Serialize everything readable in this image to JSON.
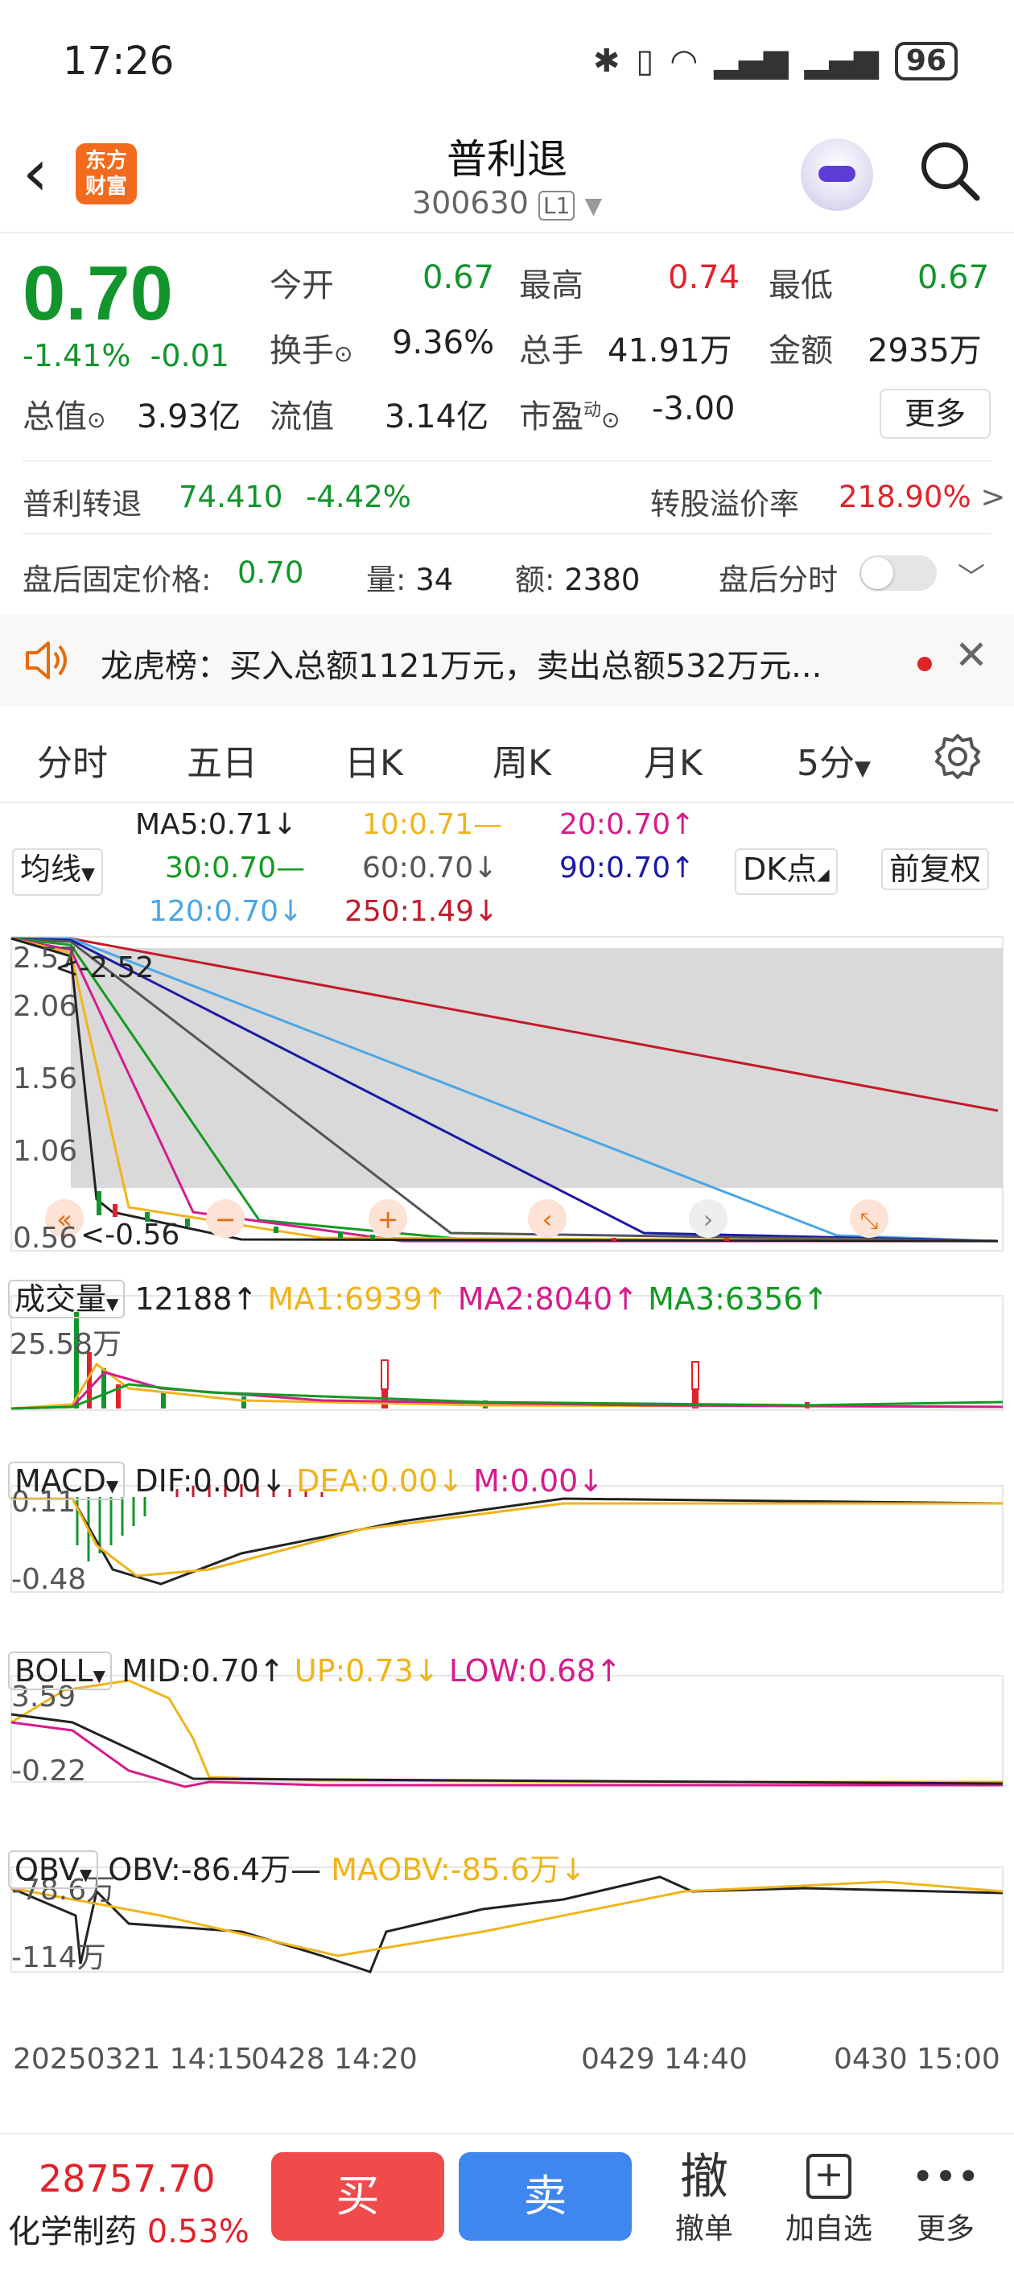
{
  "status_bar": {
    "time": "17:26",
    "battery": "96"
  },
  "nav": {
    "logo_line1": "东方",
    "logo_line2": "财富",
    "title": "普利退",
    "code": "300630",
    "level": "L1"
  },
  "quote": {
    "price": "0.70",
    "change_pct": "-1.41%",
    "change": "-0.01",
    "open_label": "今开",
    "open": "0.67",
    "high_label": "最高",
    "high": "0.74",
    "low_label": "最低",
    "low": "0.67",
    "turnover_label": "换手",
    "turnover": "9.36%",
    "volume_label": "总手",
    "volume": "41.91万",
    "amount_label": "金额",
    "amount": "2935万",
    "mktcap_label": "总值",
    "mktcap": "3.93亿",
    "float_label": "流值",
    "float": "3.14亿",
    "pe_label": "市盈",
    "pe_sup": "动",
    "pe": "-3.00",
    "more": "更多"
  },
  "bond": {
    "name": "普利转退",
    "price": "74.410",
    "pct": "-4.42%",
    "premium_label": "转股溢价率",
    "premium": "218.90%"
  },
  "after_hours": {
    "fixed_label": "盘后固定价格:",
    "fixed": "0.70",
    "vol_label": "量:",
    "vol": "34",
    "amt_label": "额:",
    "amt": "2380",
    "timeshare_label": "盘后分时"
  },
  "dragon": {
    "text": "龙虎榜：买入总额1121万元，卖出总额532万元..."
  },
  "tabs": [
    "分时",
    "五日",
    "日K",
    "周K",
    "月K",
    "5分"
  ],
  "ma_legend": {
    "selector": "均线",
    "dk": "DK点",
    "adjust": "前复权",
    "ma5": "MA5:0.71↓",
    "ma10": "10:0.71—",
    "ma20": "20:0.70↑",
    "ma30": "30:0.70—",
    "ma60": "60:0.70↓",
    "ma90": "90:0.70↑",
    "ma120": "120:0.70↓",
    "ma250": "250:1.49↓"
  },
  "main_chart": {
    "y1": "2.57",
    "y2": "2.06",
    "y3": "1.56",
    "y4": "1.06",
    "y5": "0.56",
    "max_label": "2.52",
    "min_label": "-0.56"
  },
  "volume": {
    "selector": "成交量",
    "value": "12188↑",
    "ma1": "MA1:6939↑",
    "ma2": "MA2:8040↑",
    "ma3": "MA3:6356↑",
    "max": "25.58万"
  },
  "macd": {
    "selector": "MACD",
    "dif": "DIF:0.00↓",
    "dea": "DEA:0.00↓",
    "m": "M:0.00↓",
    "top": "0.11",
    "bottom": "-0.48"
  },
  "boll": {
    "selector": "BOLL",
    "mid": "MID:0.70↑",
    "up": "UP:0.73↓",
    "low": "LOW:0.68↑",
    "top": "3.59",
    "bottom": "-0.22"
  },
  "obv": {
    "selector": "OBV",
    "obv": "OBV:-86.4万—",
    "maobv": "MAOBV:-85.6万↓",
    "top": "-78.6万",
    "bottom": "-114万"
  },
  "x_axis": {
    "d1": "20250321 14:15",
    "d2": "0428 14:20",
    "d3": "0429 14:40",
    "d4": "0430 15:00"
  },
  "bottom_bar": {
    "index_value": "28757.70",
    "index_name": "化学制药",
    "index_pct": "0.53%",
    "buy": "买",
    "sell": "卖",
    "cancel_icon": "撤",
    "cancel": "撤单",
    "watch": "加自选",
    "more": "更多"
  }
}
